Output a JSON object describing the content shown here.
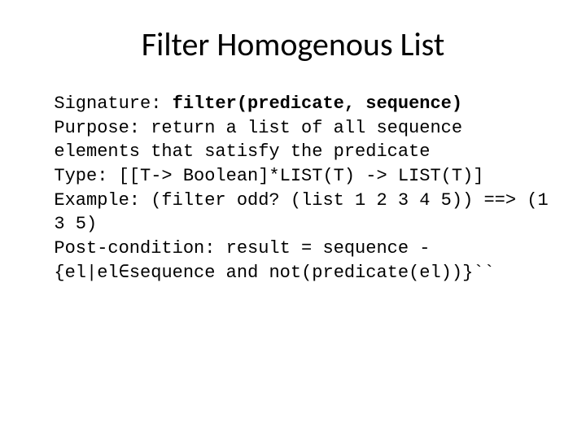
{
  "title": "Filter Homogenous List",
  "lines": {
    "l1a": "Signature: ",
    "l1b": "filter(predicate, sequence)",
    "l2": "Purpose: return a list of all sequence elements that satisfy the predicate",
    "l3": "Type: [[T-> Boolean]*LIST(T) -> LIST(T)]",
    "l4": "Example: (filter odd? (list 1 2 3 4 5)) ==> (1 3 5)",
    "l5": "Post-condition: result = sequence - {el|el∈sequence and not(predicate(el))}``"
  }
}
